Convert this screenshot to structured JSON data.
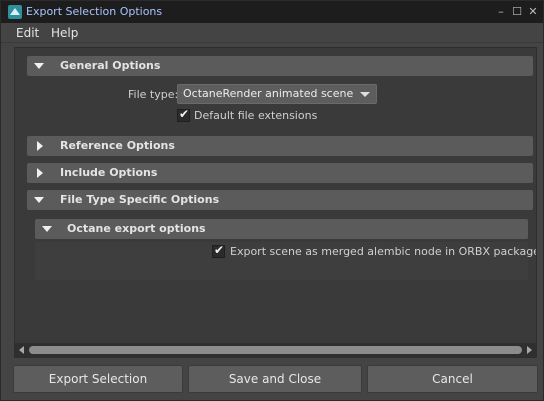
{
  "window": {
    "title": "Export Selection Options",
    "icon": "maya-app-icon",
    "controls": {
      "minimize": "–",
      "maximize": "☐",
      "close": "✕"
    }
  },
  "menubar": {
    "items": [
      {
        "label": "Edit"
      },
      {
        "label": "Help"
      }
    ]
  },
  "sections": {
    "general": {
      "title": "General Options",
      "expanded": true,
      "file_type_label": "File type:",
      "file_type_value": "OctaneRender animated scene",
      "default_ext_label": "Default file extensions",
      "default_ext_checked": true
    },
    "reference": {
      "title": "Reference Options",
      "expanded": false
    },
    "include": {
      "title": "Include Options",
      "expanded": false
    },
    "file_type_specific": {
      "title": "File Type Specific Options",
      "expanded": true,
      "octane": {
        "title": "Octane export options",
        "expanded": true,
        "merged_alembic_label": "Export scene as merged alembic node in ORBX package",
        "merged_alembic_checked": true
      }
    }
  },
  "footer": {
    "export_label": "Export Selection",
    "save_close_label": "Save and Close",
    "cancel_label": "Cancel"
  },
  "colors": {
    "background": "#444444",
    "titlebar": "#1d1d1d",
    "title_text": "#a7c5ff",
    "section_header": "#5b5b5b",
    "button": "#5d5d5d"
  }
}
